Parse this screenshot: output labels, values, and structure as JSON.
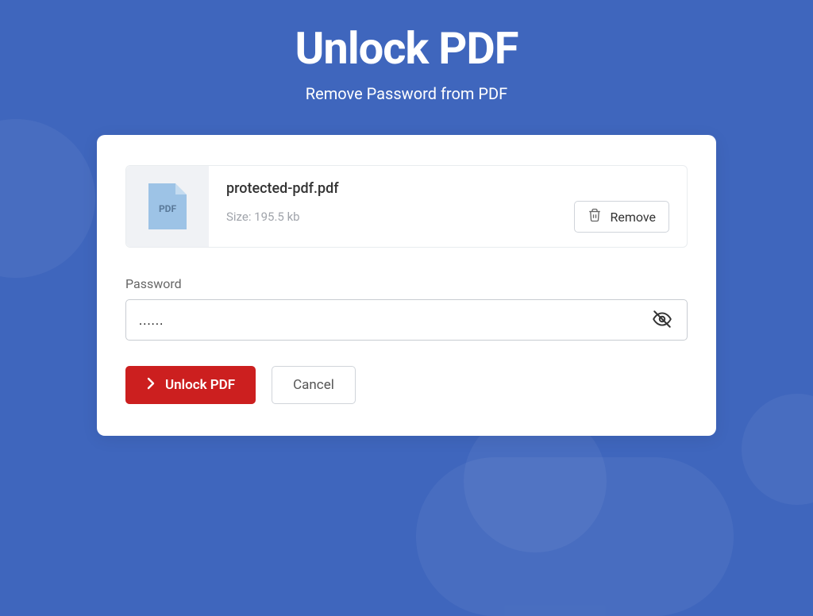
{
  "header": {
    "title": "Unlock PDF",
    "subtitle": "Remove Password from PDF"
  },
  "file": {
    "icon_label": "PDF",
    "name": "protected-pdf.pdf",
    "size_label": "Size: 195.5 kb",
    "remove_label": "Remove"
  },
  "password": {
    "label": "Password",
    "value": "......"
  },
  "actions": {
    "unlock_label": "Unlock PDF",
    "cancel_label": "Cancel"
  }
}
